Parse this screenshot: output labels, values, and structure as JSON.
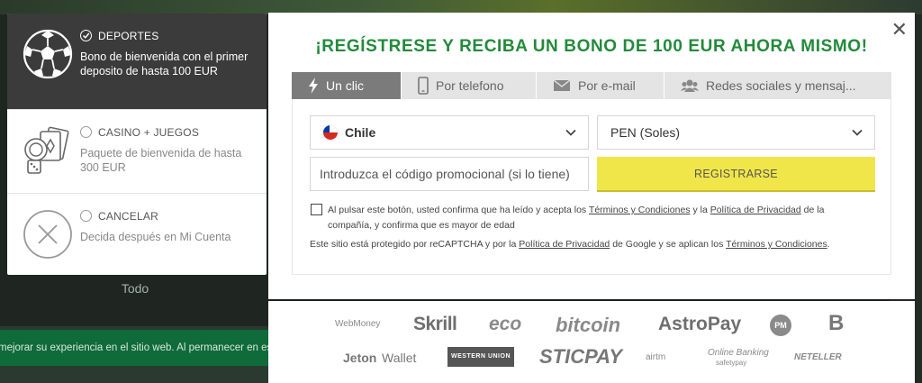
{
  "bonus_options": [
    {
      "title": "DEPORTES",
      "description": "Bono de bienvenida con el primer deposito de hasta 100 EUR",
      "selected": true,
      "icon": "soccer-ball-icon"
    },
    {
      "title": "CASINO + JUEGOS",
      "description": "Paquete de bienvenida de hasta 300 EUR",
      "selected": false,
      "icon": "casino-chips-cards-icon"
    },
    {
      "title": "CANCELAR",
      "description": "Decida después en Mi Cuenta",
      "selected": false,
      "icon": "cancel-x-icon"
    }
  ],
  "background": {
    "footer_text": "Todo",
    "cookie_banner": "mejorar su experiencia en el sitio web. Al permanecer en esta"
  },
  "modal": {
    "headline": "¡REGÍSTRESE Y RECIBA UN BONO DE 100 EUR AHORA MISMO!",
    "close_label": "✕",
    "tabs": [
      {
        "label": "Un clic",
        "icon": "lightning-icon",
        "active": true
      },
      {
        "label": "Por telefono",
        "icon": "phone-icon",
        "active": false
      },
      {
        "label": "Por e-mail",
        "icon": "envelope-icon",
        "active": false
      },
      {
        "label": "Redes sociales y mensaj...",
        "icon": "users-icon",
        "active": false
      }
    ],
    "country": "Chile",
    "currency": "PEN (Soles)",
    "promo_placeholder": "Introduzca el código promocional (si lo tiene)",
    "register_label": "REGISTRARSE",
    "terms_part1": "Al pulsar este botón, usted confirma que ha leído y acepta los",
    "terms_link1": "Términos y Condiciones",
    "terms_part2": "y la",
    "terms_link2": "Política de Privacidad",
    "terms_part3": "de la compañía, y confirma que es mayor de edad",
    "captcha_part1": "Este sitio está protegido por reCAPTCHA y por la",
    "captcha_link1": "Política de Privacidad",
    "captcha_part2": "de Google y se aplican los",
    "captcha_link2": "Términos y Condiciones",
    "captcha_end": "."
  },
  "payment_logos": {
    "row1": [
      "WebMoney",
      "Skrill",
      "eco",
      "bitcoin",
      "AstroPay",
      "PM",
      "B"
    ],
    "row2": [
      "Jeton",
      "Wallet",
      "WESTERN UNION",
      "STICPAY",
      "airtm",
      "Online Banking",
      "safetypay",
      "NETELLER"
    ]
  },
  "colors": {
    "accent_green": "#238a3b",
    "register_yellow": "#f0e64a",
    "active_tab": "#7b7b7b",
    "active_option": "#3b3b3b"
  }
}
